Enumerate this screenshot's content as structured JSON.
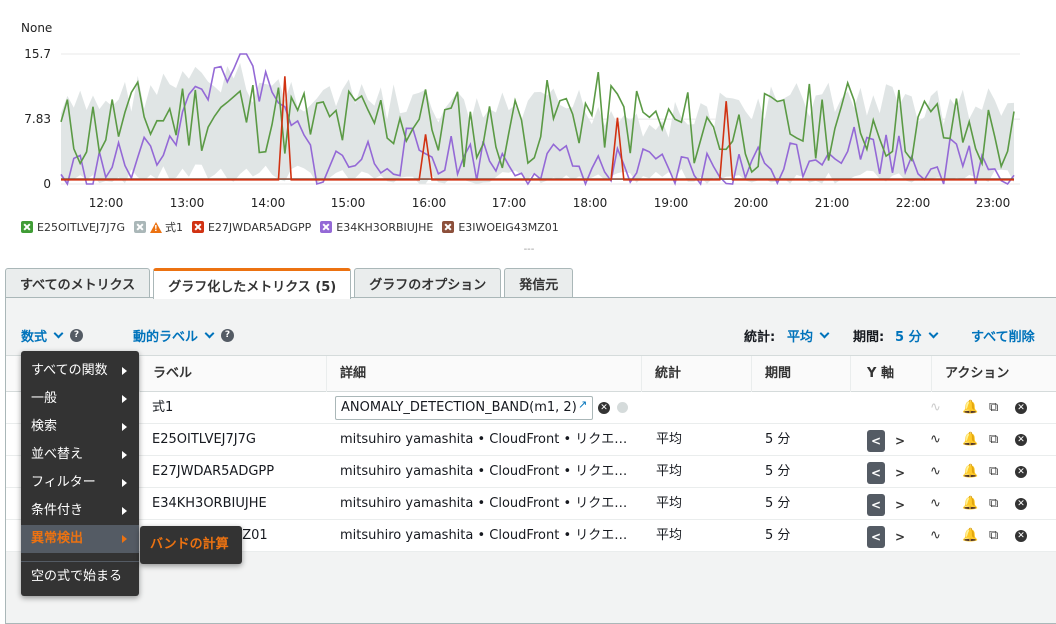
{
  "chart": {
    "ylabel": "None",
    "yticks": [
      "15.7",
      "7.83",
      "0"
    ],
    "xticks": [
      "12:00",
      "13:00",
      "14:00",
      "15:00",
      "16:00",
      "17:00",
      "18:00",
      "19:00",
      "20:00",
      "21:00",
      "22:00",
      "23:00"
    ]
  },
  "legend": [
    {
      "label": "E25OITLVEJ7J7G",
      "color": "#3f9c35"
    },
    {
      "label": "式1",
      "color": "#aab7b8",
      "warning": true
    },
    {
      "label": "E27JWDAR5ADGPP",
      "color": "#d13212"
    },
    {
      "label": "E34KH3ORBIUJHE",
      "color": "#9469d6"
    },
    {
      "label": "E3IWOEIG43MZ01",
      "color": "#8c4f3a"
    }
  ],
  "chart_data": {
    "type": "line",
    "x": [
      "12:00",
      "13:00",
      "14:00",
      "15:00",
      "16:00",
      "17:00",
      "18:00",
      "19:00",
      "20:00",
      "21:00",
      "22:00",
      "23:00"
    ],
    "ylim": [
      0,
      15.7
    ],
    "yticks": [
      0,
      7.83,
      15.7
    ],
    "ylabel": "None",
    "series": [
      {
        "name": "E25OITLVEJ7J7G",
        "color": "#5b9a45",
        "values": [
          6,
          8,
          9,
          7,
          8,
          6,
          9,
          7,
          6,
          8,
          7,
          5
        ]
      },
      {
        "name": "式1",
        "color": "#e0e5e5",
        "band": [
          [
            1,
            11
          ],
          [
            2,
            14
          ],
          [
            3,
            15
          ],
          [
            2,
            13
          ],
          [
            1,
            12
          ],
          [
            2,
            11
          ],
          [
            1,
            12
          ],
          [
            2,
            10
          ],
          [
            1,
            12
          ],
          [
            2,
            13
          ],
          [
            1,
            12
          ],
          [
            2,
            12
          ]
        ]
      },
      {
        "name": "E27JWDAR5ADGPP",
        "color": "#d13212",
        "values": [
          0.5,
          0.5,
          0.5,
          0.5,
          0.5,
          0.5,
          0.5,
          0.5,
          0.5,
          0.5,
          0.5,
          0.5
        ],
        "spikes": [
          13,
          6,
          8,
          10
        ]
      },
      {
        "name": "E34KH3ORBIUJHE",
        "color": "#9469d6",
        "values": [
          1,
          3,
          15.7,
          2,
          4,
          3,
          2,
          1,
          2,
          5,
          3,
          2
        ]
      },
      {
        "name": "E3IWOEIG43MZ01",
        "color": "#8c4f3a",
        "values": [
          0.6,
          0.6,
          0.6,
          0.6,
          0.6,
          0.6,
          0.6,
          0.6,
          0.6,
          0.6,
          0.6,
          0.6
        ]
      }
    ]
  },
  "resize_handle": "---",
  "tabs": [
    {
      "label": "すべてのメトリクス",
      "active": false
    },
    {
      "label": "グラフ化したメトリクス (5)",
      "active": true
    },
    {
      "label": "グラフのオプション",
      "active": false
    },
    {
      "label": "発信元",
      "active": false
    }
  ],
  "toolbar": {
    "math_label": "数式",
    "dynamic_label": "動的ラベル",
    "stat_label": "統計:",
    "stat_value": "平均",
    "period_label": "期間:",
    "period_value": "5 分",
    "delete_all": "すべて削除"
  },
  "columns": {
    "label": "ラベル",
    "details": "詳細",
    "stat": "統計",
    "period": "期間",
    "yaxis": "Y 軸",
    "actions": "アクション"
  },
  "rows": [
    {
      "label": "式1",
      "details": "ANOMALY_DETECTION_BAND(m1, 2)",
      "stat": "",
      "period": "",
      "is_expression": true
    },
    {
      "label": "E25OITLVEJ7J7G",
      "details": "mitsuhiro yamashita • CloudFront • リクエ…",
      "stat": "平均",
      "period": "5 分"
    },
    {
      "label": "E27JWDAR5ADGPP",
      "details": "mitsuhiro yamashita • CloudFront • リクエ…",
      "stat": "平均",
      "period": "5 分"
    },
    {
      "label": "E34KH3ORBIUJHE",
      "details": "mitsuhiro yamashita • CloudFront • リクエ…",
      "stat": "平均",
      "period": "5 分"
    },
    {
      "label": "MZ01",
      "details": "mitsuhiro yamashita • CloudFront • リクエ…",
      "stat": "平均",
      "period": "5 分"
    }
  ],
  "menu": {
    "items": [
      {
        "label": "すべての関数",
        "has_submenu": true
      },
      {
        "label": "一般",
        "has_submenu": true
      },
      {
        "label": "検索",
        "has_submenu": true
      },
      {
        "label": "並べ替え",
        "has_submenu": true
      },
      {
        "label": "フィルター",
        "has_submenu": true
      },
      {
        "label": "条件付き",
        "has_submenu": true
      },
      {
        "label": "異常検出",
        "has_submenu": true,
        "active": true
      }
    ],
    "footer": "空の式で始まる",
    "submenu": {
      "label": "バンドの計算"
    }
  },
  "colors": {
    "accent": "#ec7211",
    "link": "#0073bb"
  }
}
